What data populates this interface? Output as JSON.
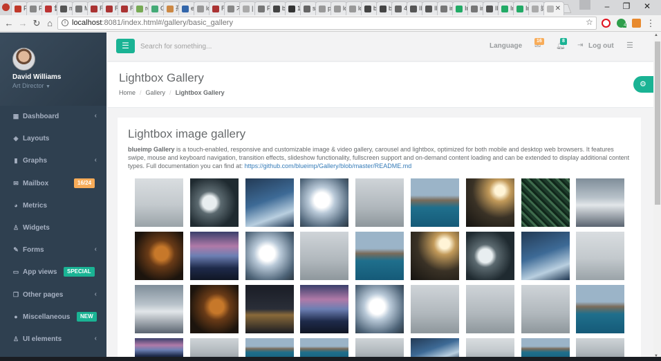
{
  "browser": {
    "tabs": [
      "P",
      "P",
      "督",
      "m",
      "M",
      "R",
      "R",
      "R",
      "re",
      "G",
      "孙",
      "el",
      "lc",
      "R",
      "才",
      "|",
      "P",
      "b",
      "1(",
      "sc",
      "p",
      "lc",
      "lc",
      "b",
      "b",
      "4",
      "IN",
      "IN",
      "in",
      "In",
      "in",
      "IN",
      "In",
      "In",
      "讓",
      ""
    ],
    "url_host": "localhost",
    "url_path": ":8081/index.html#/gallery/basic_gallery",
    "ext_badge": "4",
    "colors": {
      "opera": "#e0101e",
      "ext_green": "#2e9e4b",
      "ext_orange": "#e88a2e"
    }
  },
  "user": {
    "name": "David Williams",
    "role": "Art Director"
  },
  "sidebar": {
    "items": [
      {
        "label": "Dashboard",
        "icon": "th-large-icon",
        "glyph": "▦",
        "arrow": "‹"
      },
      {
        "label": "Layouts",
        "icon": "diamond-icon",
        "glyph": "◈",
        "arrow": ""
      },
      {
        "label": "Graphs",
        "icon": "bar-chart-icon",
        "glyph": "▮",
        "arrow": "‹"
      },
      {
        "label": "Mailbox",
        "icon": "envelope-icon",
        "glyph": "✉",
        "arrow": "",
        "badge": "16/24",
        "badge_color": "#f8ac59"
      },
      {
        "label": "Metrics",
        "icon": "pie-chart-icon",
        "glyph": "◕",
        "arrow": ""
      },
      {
        "label": "Widgets",
        "icon": "flask-icon",
        "glyph": "♙",
        "arrow": ""
      },
      {
        "label": "Forms",
        "icon": "edit-icon",
        "glyph": "✎",
        "arrow": "‹"
      },
      {
        "label": "App views",
        "icon": "desktop-icon",
        "glyph": "▭",
        "arrow": "",
        "badge": "SPECIAL",
        "badge_color": "#1ab394"
      },
      {
        "label": "Other pages",
        "icon": "files-icon",
        "glyph": "❐",
        "arrow": "‹"
      },
      {
        "label": "Miscellaneous",
        "icon": "globe-icon",
        "glyph": "●",
        "arrow": "",
        "badge": "NEW",
        "badge_color": "#1ab394"
      },
      {
        "label": "UI elements",
        "icon": "flask-icon",
        "glyph": "♙",
        "arrow": "‹"
      }
    ]
  },
  "topbar": {
    "search_placeholder": "Search for something...",
    "language": "Language",
    "messages_count": "16",
    "alerts_count": "8",
    "logout": "Log out",
    "colors": {
      "accent": "#1ab394",
      "warning": "#f8ac59"
    }
  },
  "heading": {
    "title": "Lightbox Gallery",
    "breadcrumb": [
      "Home",
      "Gallery",
      "Lightbox Gallery"
    ]
  },
  "content": {
    "title": "Lightbox image gallery",
    "desc_bold": "blueimp Gallery",
    "desc_text": " is a touch-enabled, responsive and customizable image & video gallery, carousel and lightbox, optimized for both mobile and desktop web browsers. It features swipe, mouse and keyboard navigation, transition effects, slideshow functionality, fullscreen support and on-demand content loading and can be extended to display additional content types. Full documentation you can find at: ",
    "desc_link": "https://github.com/blueimp/Gallery/blob/master/README.md"
  },
  "gallery": {
    "images": [
      "bridge",
      "aerial-surf",
      "ocean-wave",
      "splash-rocks",
      "seagulls",
      "coast-sea",
      "sunset-silhouette",
      "fern",
      "boat-bow",
      "tiger",
      "mountain-dusk",
      "splash-rocks",
      "seagulls",
      "coast-sea",
      "sunset-silhouette",
      "aerial-surf",
      "ocean-wave",
      "bridge",
      "boat-bow",
      "tiger",
      "night-pier",
      "mountain-dusk",
      "splash-rocks",
      "seagulls",
      "seagulls",
      "seagulls",
      "coast-sea",
      "mountain-dusk",
      "seagulls",
      "coast-sea",
      "coast-sea",
      "seagulls",
      "ocean-wave",
      "bridge",
      "coast-sea",
      "seagulls"
    ]
  }
}
